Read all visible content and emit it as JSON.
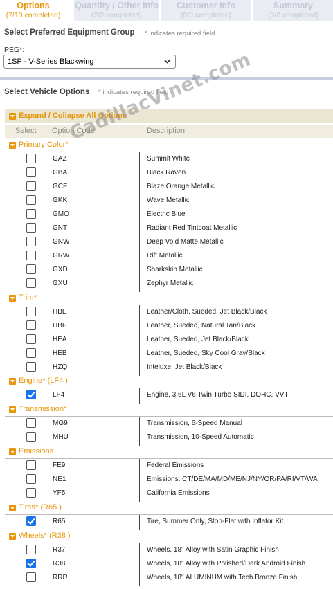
{
  "tabs": [
    {
      "title": "Options",
      "sub": "(7/10 completed)"
    },
    {
      "title": "Quantity / Other Info",
      "sub": "(2/2 completed)"
    },
    {
      "title": "Customer Info",
      "sub": "(0/8 completed)"
    },
    {
      "title": "Summary",
      "sub": "(0/0 completed)"
    }
  ],
  "peg_section": {
    "title": "Select Preferred Equipment Group",
    "required_note": "* indicates required field",
    "label": "PEG*:",
    "selected": "1SP - V-Series Blackwing"
  },
  "options_section": {
    "title": "Select Vehicle Options",
    "required_note": "* indicates required field",
    "expand_label": "Expand / Collapse All Options",
    "columns": {
      "select": "Select",
      "code": "Option Code",
      "description": "Description"
    }
  },
  "watermark": "CadillacVinet.com",
  "groups": [
    {
      "name": "Primary Color*",
      "items": [
        {
          "code": "GAZ",
          "desc": "Summit White",
          "checked": false
        },
        {
          "code": "GBA",
          "desc": "Black Raven",
          "checked": false
        },
        {
          "code": "GCF",
          "desc": "Blaze Orange Metallic",
          "checked": false
        },
        {
          "code": "GKK",
          "desc": "Wave Metallic",
          "checked": false
        },
        {
          "code": "GMO",
          "desc": "Electric Blue",
          "checked": false
        },
        {
          "code": "GNT",
          "desc": "Radiant Red Tintcoat Metallic",
          "checked": false
        },
        {
          "code": "GNW",
          "desc": "Deep Void Matte Metallic",
          "checked": false
        },
        {
          "code": "GRW",
          "desc": "Rift Metallic",
          "checked": false
        },
        {
          "code": "GXD",
          "desc": "Sharkskin Metallic",
          "checked": false
        },
        {
          "code": "GXU",
          "desc": "Zephyr Metallic",
          "checked": false
        }
      ]
    },
    {
      "name": "Trim*",
      "items": [
        {
          "code": "HBE",
          "desc": "Leather/Cloth, Sueded, Jet Black/Black",
          "checked": false
        },
        {
          "code": "HBF",
          "desc": "Leather, Sueded, Natural Tan/Black",
          "checked": false
        },
        {
          "code": "HEA",
          "desc": "Leather, Sueded, Jet Black/Black",
          "checked": false
        },
        {
          "code": "HEB",
          "desc": "Leather, Sueded, Sky Cool Gray/Black",
          "checked": false
        },
        {
          "code": "HZQ",
          "desc": "Inteluxe, Jet Black/Black",
          "checked": false
        }
      ]
    },
    {
      "name": "Engine*  (LF4 )",
      "items": [
        {
          "code": "LF4",
          "desc": "Engine, 3.6L V6 Twin Turbo SIDI, DOHC, VVT",
          "checked": true
        }
      ]
    },
    {
      "name": "Transmission*",
      "items": [
        {
          "code": "MG9",
          "desc": "Transmission, 6-Speed Manual",
          "checked": false
        },
        {
          "code": "MHU",
          "desc": "Transmission, 10-Speed Automatic",
          "checked": false
        }
      ]
    },
    {
      "name": "Emissions",
      "items": [
        {
          "code": "FE9",
          "desc": "Federal Emissions",
          "checked": false
        },
        {
          "code": "NE1",
          "desc": "Emissions: CT/DE/MA/MD/ME/NJ/NY/OR/PA/RI/VT/WA",
          "checked": false
        },
        {
          "code": "YF5",
          "desc": "California Emissions",
          "checked": false
        }
      ]
    },
    {
      "name": "Tires*  (R65 )",
      "items": [
        {
          "code": "R65",
          "desc": "Tire, Summer Only, Stop-Flat with Inflator Kit.",
          "checked": true
        }
      ]
    },
    {
      "name": "Wheels*  (R38 )",
      "items": [
        {
          "code": "R37",
          "desc": "Wheels, 18\" Alloy with Satin Graphic Finish",
          "checked": false
        },
        {
          "code": "R38",
          "desc": "Wheels, 18\" Alloy with Polished/Dark Android Finish",
          "checked": true
        },
        {
          "code": "RRR",
          "desc": "Wheels, 18\" ALUMINUM with Tech Bronze Finish",
          "checked": false
        }
      ]
    }
  ]
}
